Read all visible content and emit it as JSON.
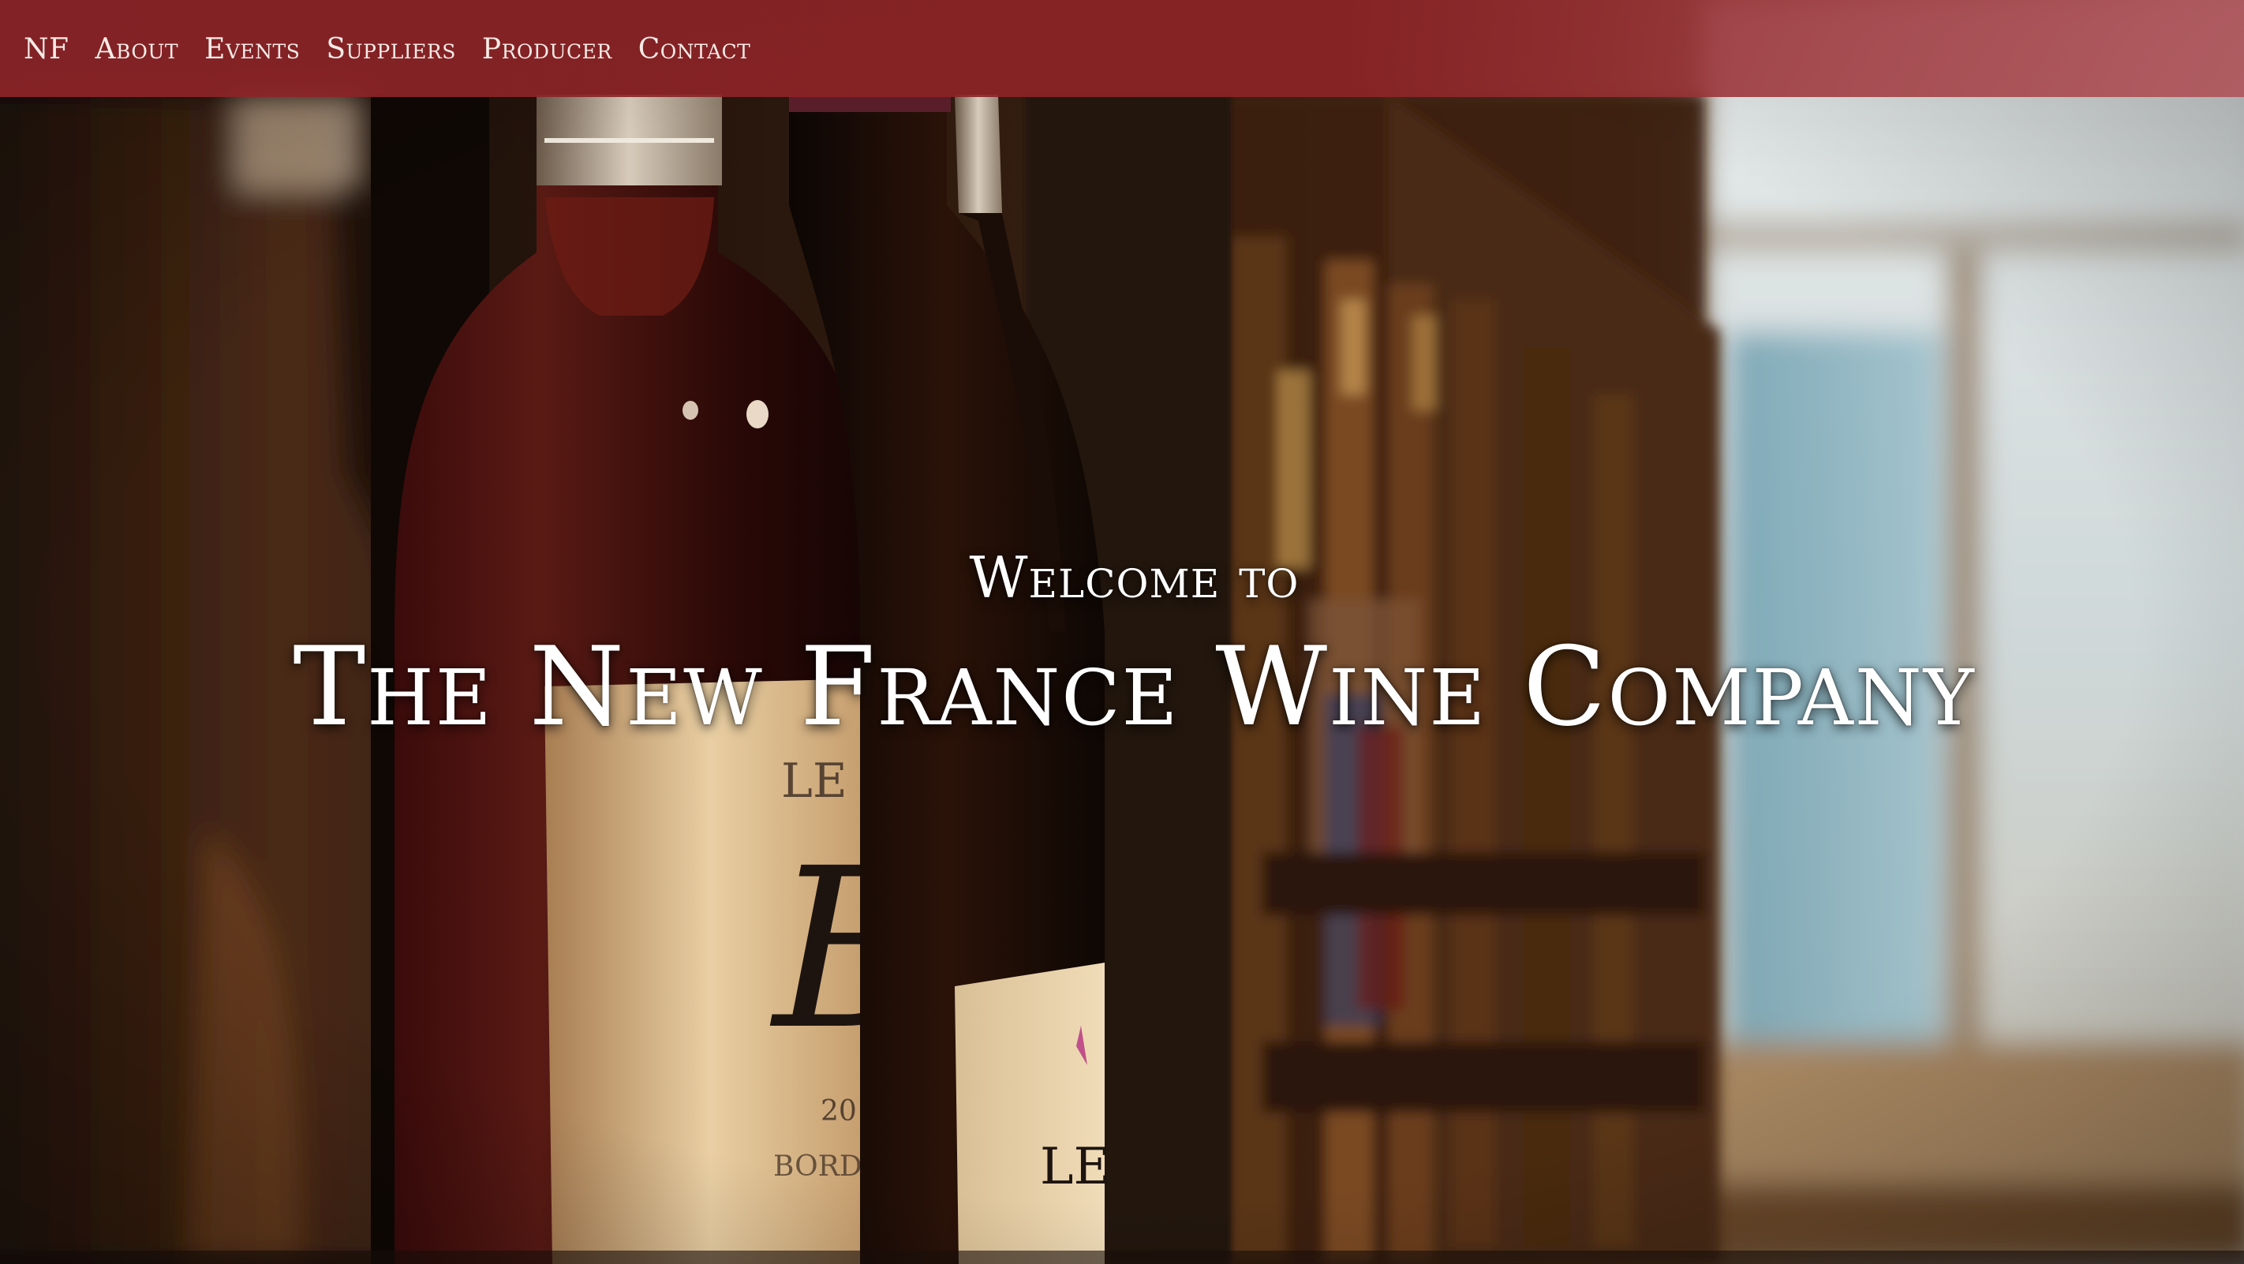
{
  "nav": {
    "items": [
      {
        "label": "NF"
      },
      {
        "label": "About"
      },
      {
        "label": "Events"
      },
      {
        "label": "Suppliers"
      },
      {
        "label": "Producer"
      },
      {
        "label": "Contact"
      }
    ]
  },
  "hero": {
    "welcome": "Welcome to",
    "title": "The New France Wine Company",
    "image_subject": "wine-bottles-on-shelf-photo"
  },
  "colors": {
    "navbar": "#8c2428",
    "navbar_right": "#b04e54",
    "nav_text": "#f7ebe6",
    "headline": "#ffffff"
  }
}
